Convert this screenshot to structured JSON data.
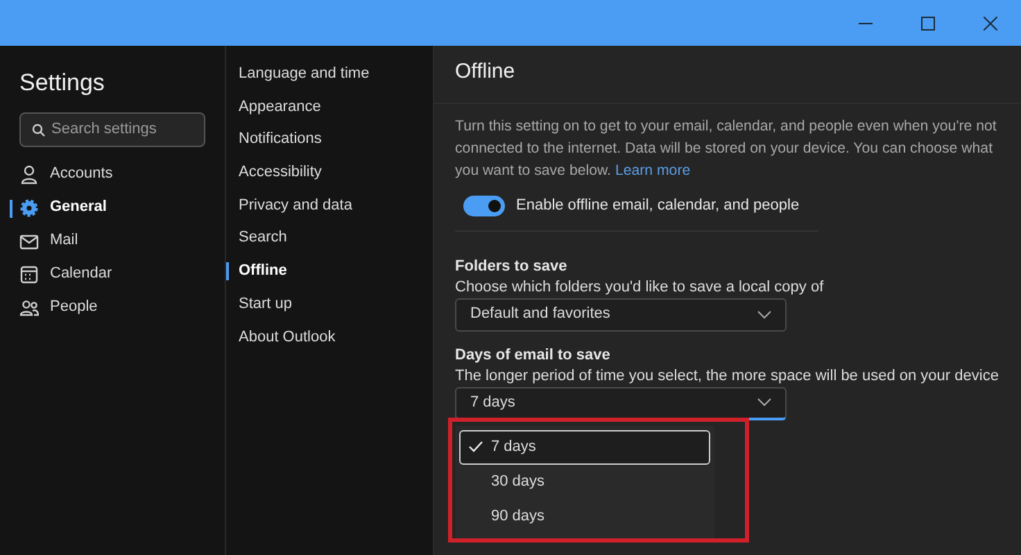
{
  "window": {
    "controls": [
      {
        "kind": "minimize"
      },
      {
        "kind": "maximize"
      },
      {
        "kind": "close"
      }
    ]
  },
  "sidebar": {
    "title": "Settings",
    "search": {
      "placeholder": "Search settings"
    },
    "items": [
      {
        "label": "Accounts",
        "kind": "person",
        "selected": false
      },
      {
        "label": "General",
        "kind": "gear",
        "selected": true
      },
      {
        "label": "Mail",
        "kind": "mail",
        "selected": false
      },
      {
        "label": "Calendar",
        "kind": "calendar",
        "selected": false
      },
      {
        "label": "People",
        "kind": "people",
        "selected": false
      }
    ]
  },
  "subnav": {
    "items": [
      {
        "label": "Language and time",
        "selected": false
      },
      {
        "label": "Appearance",
        "selected": false
      },
      {
        "label": "Notifications",
        "selected": false
      },
      {
        "label": "Accessibility",
        "selected": false
      },
      {
        "label": "Privacy and data",
        "selected": false
      },
      {
        "label": "Search",
        "selected": false
      },
      {
        "label": "Offline",
        "selected": true
      },
      {
        "label": "Start up",
        "selected": false
      },
      {
        "label": "About Outlook",
        "selected": false
      }
    ]
  },
  "content": {
    "title": "Offline",
    "description": "Turn this setting on to get to your email, calendar, and people even when you're not connected to the internet. Data will be stored on your device. You can choose what you want to save below.",
    "link": "Learn more",
    "toggle": {
      "label": "Enable offline email, calendar, and people",
      "on": true
    },
    "sections": [
      {
        "heading": "Folders to save",
        "hint": "Choose which folders you'd like to save a local copy of",
        "value": "Default and favorites",
        "expanded": false
      },
      {
        "heading": "Days of email to save",
        "hint": "The longer period of time you select, the more space will be used on your device",
        "value": "7 days",
        "expanded": true,
        "highlighted": true,
        "options": [
          {
            "label": "7 days",
            "selected": true
          },
          {
            "label": "30 days",
            "selected": false
          },
          {
            "label": "90 days",
            "selected": false
          }
        ]
      }
    ]
  }
}
